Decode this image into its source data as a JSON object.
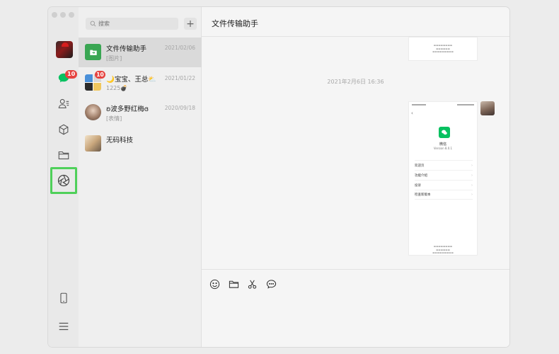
{
  "search": {
    "placeholder": "搜索"
  },
  "rail": {
    "chat_badge": "10"
  },
  "chats": [
    {
      "name": "文件传输助手",
      "preview": "[图片]",
      "date": "2021/02/06"
    },
    {
      "name": "🌙宝宝、王总⛅",
      "preview": "1225💣",
      "date": "2021/01/22",
      "badge": "10"
    },
    {
      "name": "ʚ波多野红梅ɞ",
      "preview": "[表情]",
      "date": "2020/09/18"
    },
    {
      "name": "无码科技",
      "preview": "",
      "date": ""
    }
  ],
  "conversation": {
    "title": "文件传输助手",
    "timestamp": "2021年2月6日 16:36"
  },
  "about_card": {
    "app_name": "微信",
    "version": "Version 8.0.1",
    "menu": [
      "欢迎页",
      "功能介绍",
      "投诉",
      "检查新版本"
    ]
  },
  "colors": {
    "accent_green": "#4fd05a",
    "badge_red": "#e64340",
    "wechat_green": "#07c160"
  }
}
